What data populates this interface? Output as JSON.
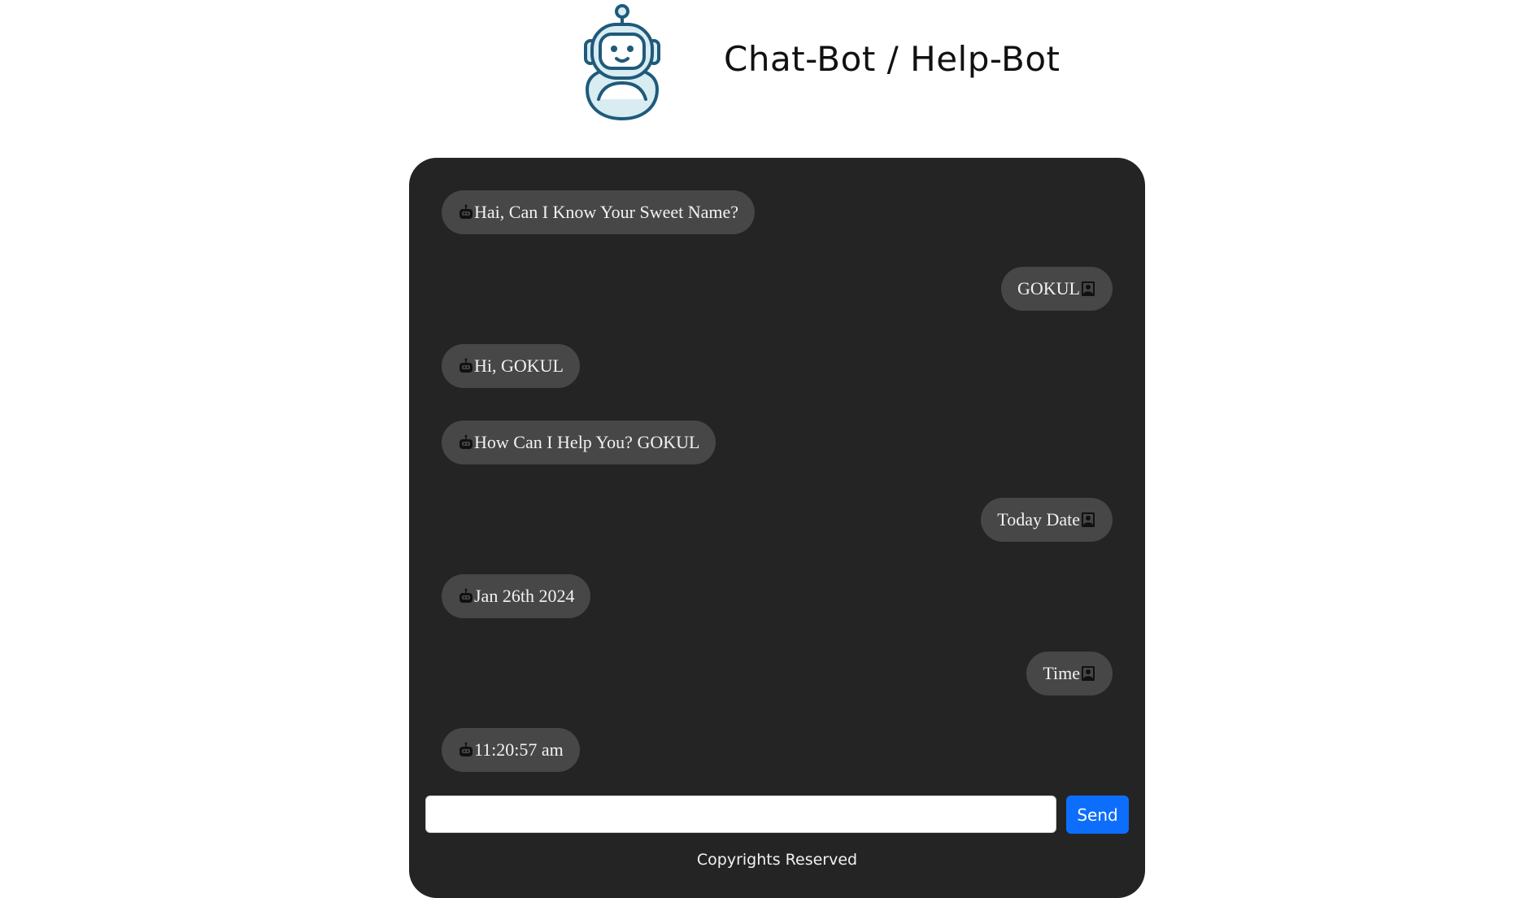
{
  "header": {
    "title": "Chat-Bot / Help-Bot",
    "logo_icon": "robot-logo-icon"
  },
  "chat": {
    "messages": [
      {
        "sender": "bot",
        "icon": "robot-icon",
        "text": "Hai, Can I Know Your Sweet Name?"
      },
      {
        "sender": "user",
        "icon": "user-icon",
        "text": "GOKUL"
      },
      {
        "sender": "bot",
        "icon": "robot-icon",
        "text": "Hi, GOKUL"
      },
      {
        "sender": "bot",
        "icon": "robot-icon",
        "text": "How Can I Help You? GOKUL"
      },
      {
        "sender": "user",
        "icon": "user-icon",
        "text": "Today Date"
      },
      {
        "sender": "bot",
        "icon": "robot-icon",
        "text": "Jan 26th 2024"
      },
      {
        "sender": "user",
        "icon": "user-icon",
        "text": "Time"
      },
      {
        "sender": "bot",
        "icon": "robot-icon",
        "text": "11:20:57 am"
      }
    ],
    "input": {
      "value": "",
      "placeholder": ""
    },
    "send_label": "Send"
  },
  "footer": {
    "text": "Copyrights Reserved"
  },
  "colors": {
    "panel_bg": "#242424",
    "bubble_bg": "#474747",
    "send_button": "#0d6efd",
    "logo_stroke": "#1f5a7a",
    "logo_fill": "#d8ecf2"
  }
}
